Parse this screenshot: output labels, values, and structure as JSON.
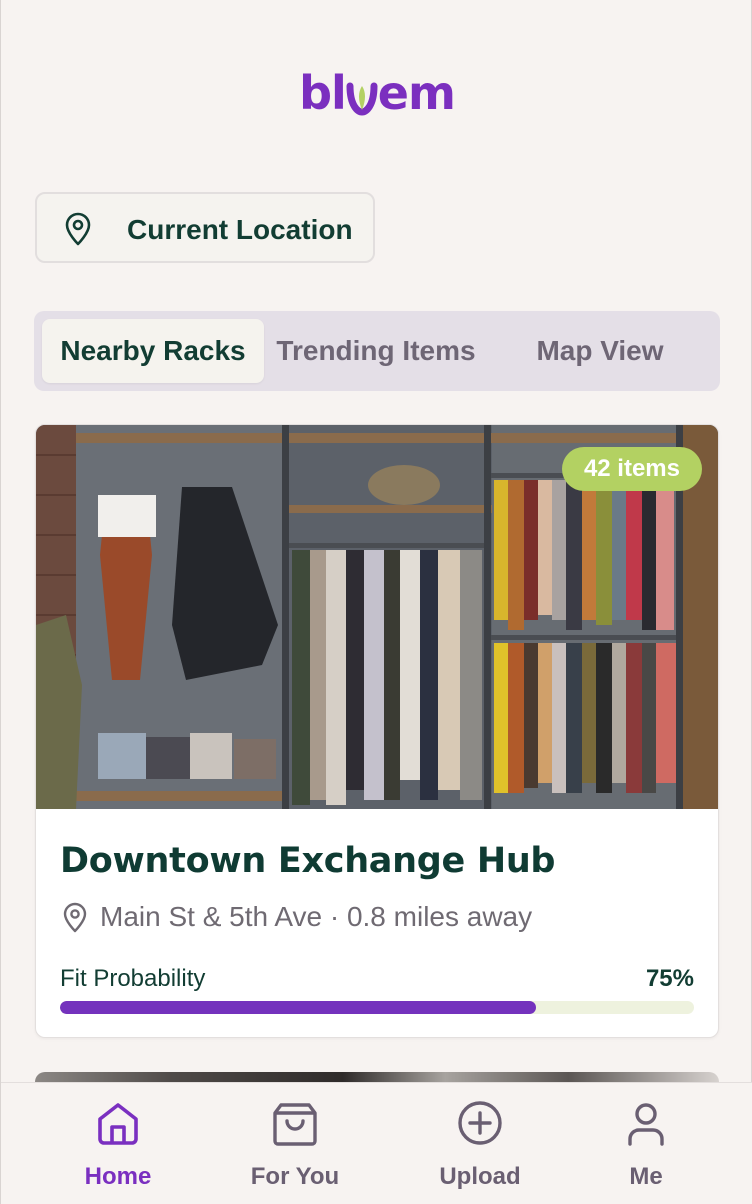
{
  "app": {
    "logo_text_left": "bl",
    "logo_text_right": "em",
    "brand_color": "#7b2fbf"
  },
  "location": {
    "label": "Current Location",
    "icon": "map-pin-icon"
  },
  "tabs": [
    {
      "label": "Nearby Racks",
      "active": true
    },
    {
      "label": "Trending Items",
      "active": false
    },
    {
      "label": "Map View",
      "active": false
    }
  ],
  "card": {
    "badge": "42 items",
    "title": "Downtown Exchange Hub",
    "location": "Main St & 5th Ave · 0.8 miles away",
    "fit_label": "Fit Probability",
    "fit_value": "75%",
    "fit_fraction": 0.75,
    "accent_color": "#7432bd",
    "badge_color": "#b3d162"
  },
  "nav": {
    "items": [
      {
        "label": "Home",
        "icon": "home-icon",
        "active": true
      },
      {
        "label": "For You",
        "icon": "shopping-bag-icon",
        "active": false
      },
      {
        "label": "Upload",
        "icon": "plus-circle-icon",
        "active": false
      },
      {
        "label": "Me",
        "icon": "user-icon",
        "active": false
      }
    ]
  }
}
